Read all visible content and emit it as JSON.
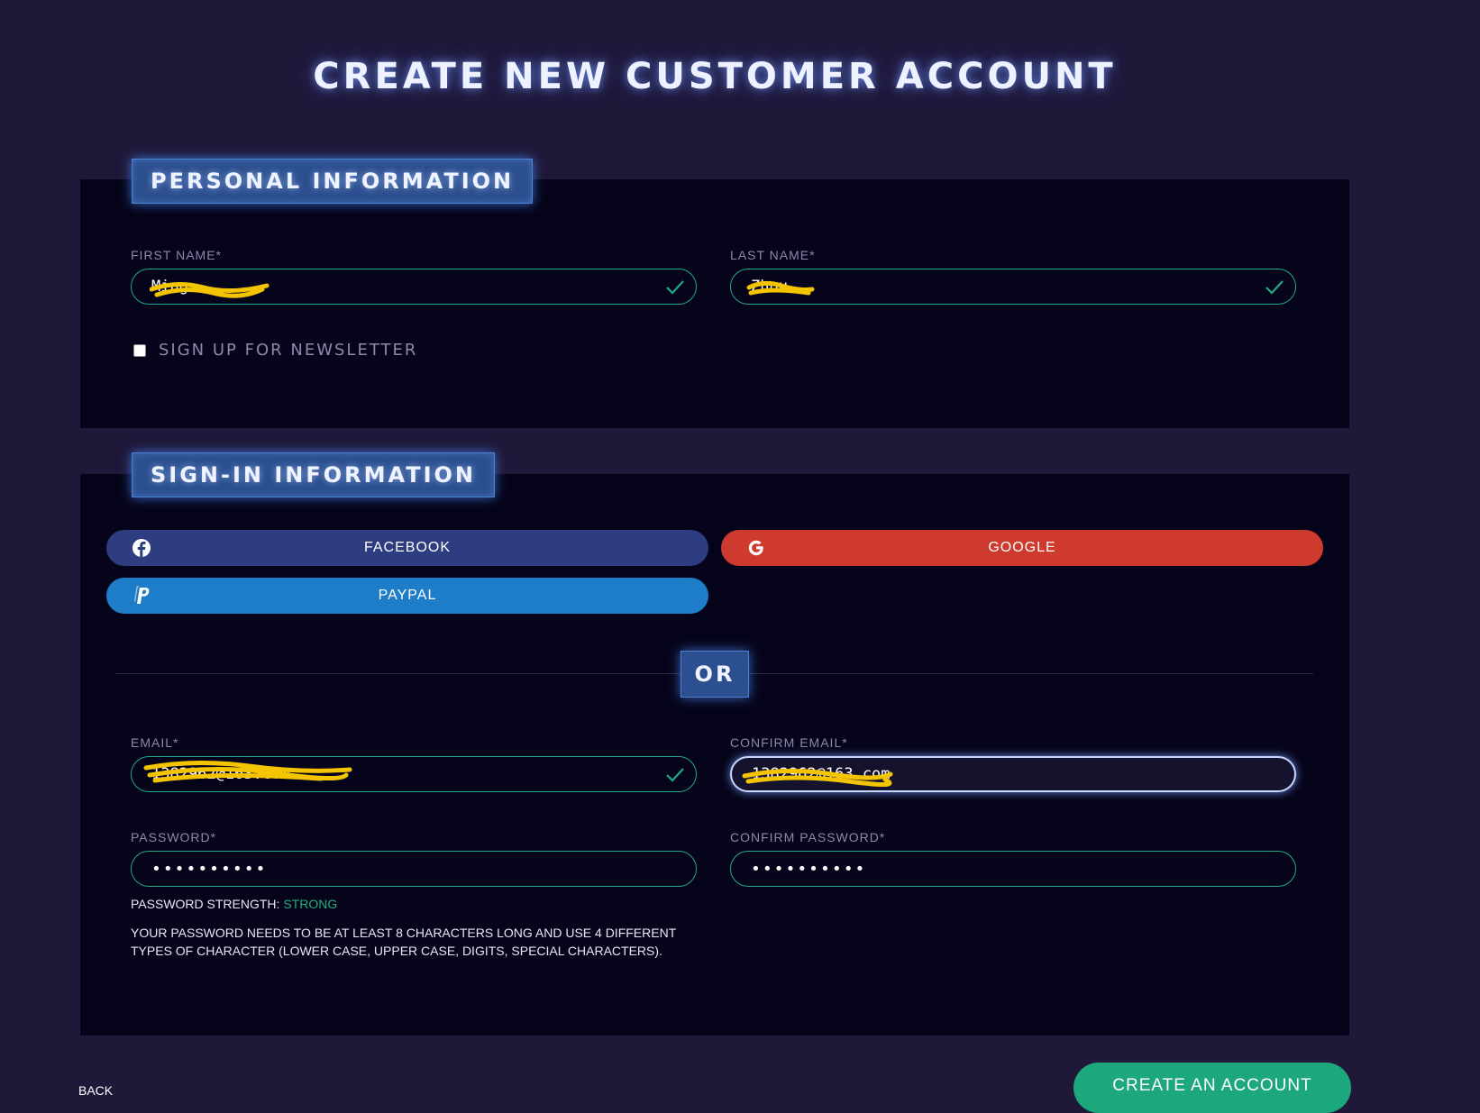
{
  "page": {
    "title": "CREATE NEW CUSTOMER ACCOUNT"
  },
  "personal": {
    "heading": "PERSONAL INFORMATION",
    "first_name": {
      "label": "FIRST NAME*",
      "value": "Ming",
      "status": "valid"
    },
    "last_name": {
      "label": "LAST NAME*",
      "value": "Zhou",
      "status": "valid"
    },
    "newsletter": {
      "label": "SIGN UP FOR NEWSLETTER",
      "checked": false
    }
  },
  "signin": {
    "heading": "SIGN-IN INFORMATION",
    "social": {
      "facebook": {
        "label": "FACEBOOK",
        "icon": "facebook-icon",
        "color": "#2e3c80"
      },
      "google": {
        "label": "GOOGLE",
        "icon": "google-icon",
        "color": "#ce3b2e"
      },
      "paypal": {
        "label": "PAYPAL",
        "icon": "paypal-icon",
        "color": "#1d7dc8"
      }
    },
    "divider_text": "OR",
    "email": {
      "label": "EMAIL*",
      "value": "1382962@163.com",
      "status": "valid"
    },
    "confirm_email": {
      "label": "CONFIRM EMAIL*",
      "value": "1382962@163.com",
      "focused": true
    },
    "password": {
      "label": "PASSWORD*",
      "value": "••••••••••"
    },
    "confirm_password": {
      "label": "CONFIRM PASSWORD*",
      "value": "••••••••••"
    },
    "strength": {
      "label": "PASSWORD STRENGTH: ",
      "value": "STRONG",
      "color": "#22b07f"
    },
    "hint": "YOUR PASSWORD NEEDS TO BE AT LEAST 8 CHARACTERS LONG AND USE 4 DIFFERENT TYPES OF CHARACTER (LOWER CASE, UPPER CASE, DIGITS, SPECIAL CHARACTERS)."
  },
  "actions": {
    "back": "BACK",
    "create": "CREATE AN ACCOUNT"
  },
  "colors": {
    "background": "#1f1839",
    "panel": "#06041a",
    "accent_green": "#1ca77c",
    "section_tag": "#2c4f8f"
  }
}
